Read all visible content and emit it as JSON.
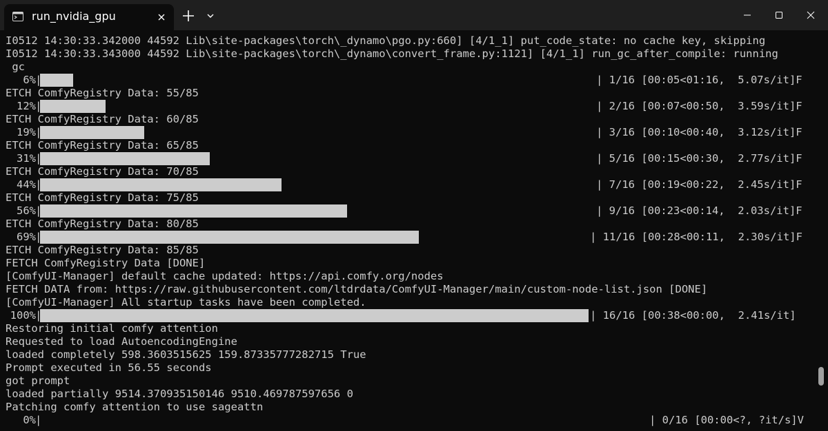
{
  "tab": {
    "title": "run_nvidia_gpu",
    "icon": "terminal-icon"
  },
  "controls": {
    "new_tab": "plus-icon",
    "dropdown": "chevron-down-icon",
    "minimize": "minimize-icon",
    "maximize": "maximize-icon",
    "close": "close-icon"
  },
  "terminal": {
    "lines": [
      "I0512 14:30:33.342000 44592 Lib\\site-packages\\torch\\_dynamo\\pgo.py:660] [4/1_1] put_code_state: no cache key, skipping",
      "I0512 14:30:33.343000 44592 Lib\\site-packages\\torch\\_dynamo\\convert_frame.py:1121] [4/1_1] run_gc_after_compile: running",
      " gc",
      "ETCH ComfyRegistry Data: 55/85",
      "ETCH ComfyRegistry Data: 60/85",
      "ETCH ComfyRegistry Data: 65/85",
      "ETCH ComfyRegistry Data: 70/85",
      "ETCH ComfyRegistry Data: 75/85",
      "ETCH ComfyRegistry Data: 80/85",
      "ETCH ComfyRegistry Data: 85/85",
      "FETCH ComfyRegistry Data [DONE]",
      "[ComfyUI-Manager] default cache updated: https://api.comfy.org/nodes",
      "FETCH DATA from: https://raw.githubusercontent.com/ltdrdata/ComfyUI-Manager/main/custom-node-list.json [DONE]",
      "[ComfyUI-Manager] All startup tasks have been completed.",
      "Restoring initial comfy attention",
      "Requested to load AutoencodingEngine",
      "loaded completely 598.3603515625 159.87335777282715 True",
      "Prompt executed in 56.55 seconds",
      "got prompt",
      "loaded partially 9514.370935150146 9510.469787597656 0",
      "Patching comfy attention to use sageattn"
    ],
    "progress": [
      {
        "percent": "6%",
        "fraction": 0.06,
        "stats": "| 1/16 [00:05<01:16,  5.07s/it]F"
      },
      {
        "percent": "12%",
        "fraction": 0.12,
        "stats": "| 2/16 [00:07<00:50,  3.59s/it]F"
      },
      {
        "percent": "19%",
        "fraction": 0.19,
        "stats": "| 3/16 [00:10<00:40,  3.12s/it]F"
      },
      {
        "percent": "31%",
        "fraction": 0.31,
        "stats": "| 5/16 [00:15<00:30,  2.77s/it]F"
      },
      {
        "percent": "44%",
        "fraction": 0.44,
        "stats": "| 7/16 [00:19<00:22,  2.45s/it]F"
      },
      {
        "percent": "56%",
        "fraction": 0.56,
        "stats": "| 9/16 [00:23<00:14,  2.03s/it]F"
      },
      {
        "percent": "69%",
        "fraction": 0.69,
        "stats": "| 11/16 [00:28<00:11,  2.30s/it]F"
      },
      {
        "percent": "100%",
        "fraction": 1.0,
        "stats": "| 16/16 [00:38<00:00,  2.41s/it]"
      },
      {
        "percent": "0%",
        "fraction": 0.0,
        "stats": "| 0/16 [00:00<?, ?it/s]V"
      }
    ]
  },
  "colors": {
    "background": "#0c0c0c",
    "titlebar": "#1f1f1f",
    "text": "#cccccc",
    "bar": "#cccccc"
  }
}
